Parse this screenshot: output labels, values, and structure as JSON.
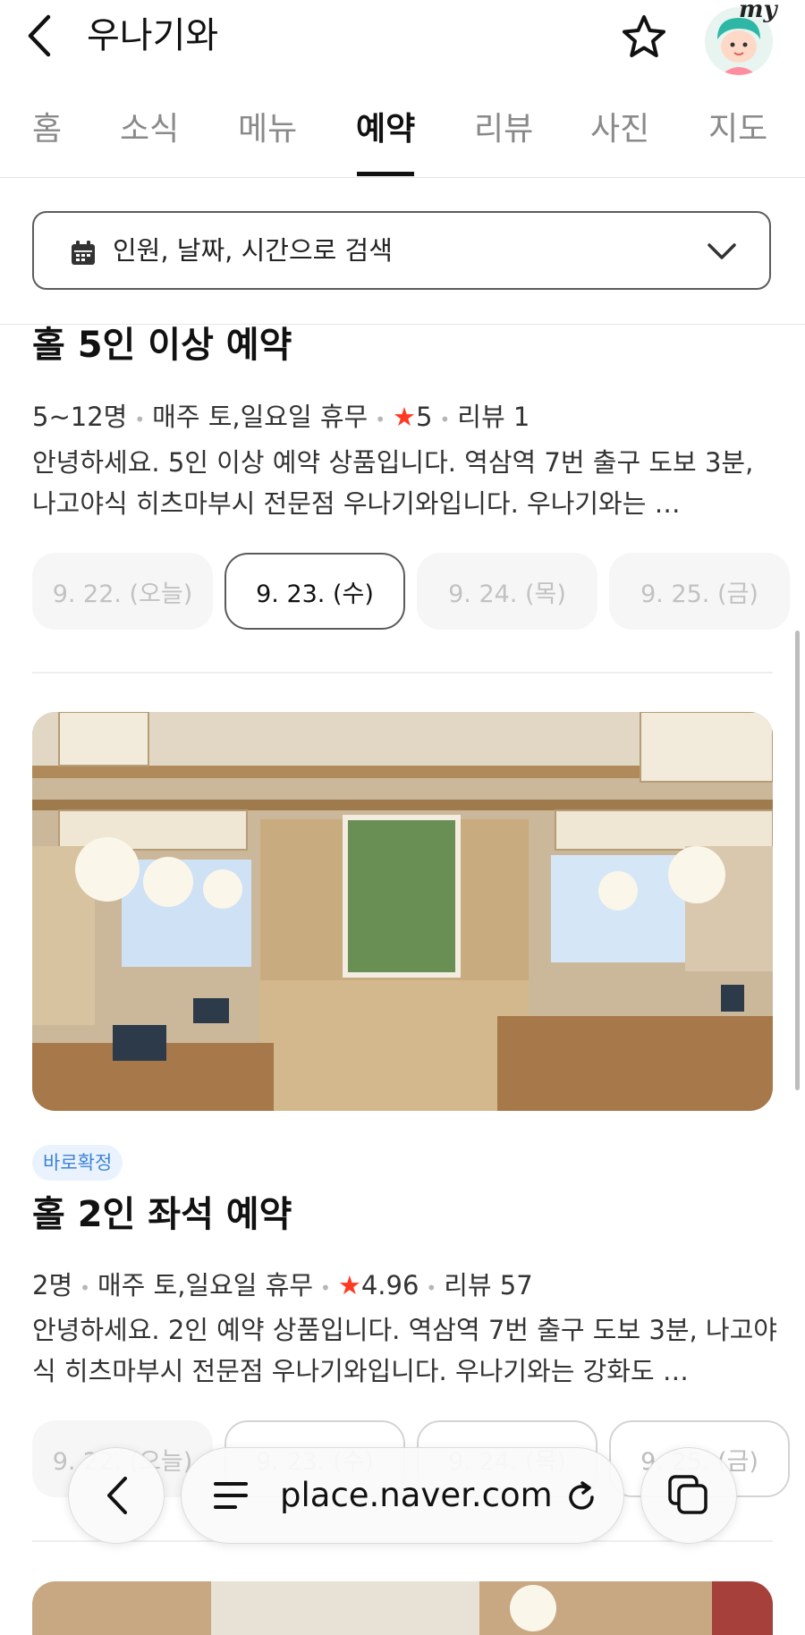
{
  "header": {
    "title": "우나기와",
    "avatar_text": "my",
    "icons": {
      "back": "chevron-left-icon",
      "favorite": "star-outline-icon"
    }
  },
  "tabs": [
    {
      "label": "홈",
      "active": false
    },
    {
      "label": "소식",
      "active": false
    },
    {
      "label": "메뉴",
      "active": false
    },
    {
      "label": "예약",
      "active": true
    },
    {
      "label": "리뷰",
      "active": false
    },
    {
      "label": "사진",
      "active": false
    },
    {
      "label": "지도",
      "active": false
    }
  ],
  "search": {
    "text": "인원, 날짜, 시간으로 검색",
    "icon": "calendar-icon"
  },
  "products": [
    {
      "title": "홀 5인 이상 예약",
      "capacity": "5~12명",
      "closed": "매주 토,일요일 휴무",
      "rating": "5",
      "reviews": "리뷰 1",
      "description": "안녕하세요. 5인 이상 예약 상품입니다. 역삼역 7번 출구 도보 3분, 나고야식 히츠마부시 전문점 우나기와입니다. 우나기와는 …",
      "dates": [
        {
          "label": "9. 22. (오늘)",
          "state": "disabled"
        },
        {
          "label": "9. 23. (수)",
          "state": "selected"
        },
        {
          "label": "9. 24. (목)",
          "state": "disabled"
        },
        {
          "label": "9. 25. (금)",
          "state": "disabled"
        }
      ]
    },
    {
      "badge": "바로확정",
      "title": "홀 2인 좌석 예약",
      "capacity": "2명",
      "closed": "매주 토,일요일 휴무",
      "rating": "4.96",
      "reviews": "리뷰 57",
      "description": "안녕하세요. 2인 예약 상품입니다. 역삼역 7번 출구 도보 3분, 나고야식 히츠마부시 전문점 우나기와입니다. 우나기와는 강화도 …",
      "dates": [
        {
          "label": "9. 22. (오늘)",
          "state": "disabled"
        },
        {
          "label": "9. 23. (수)",
          "state": "available"
        },
        {
          "label": "9. 24. (목)",
          "state": "available"
        },
        {
          "label": "9. 25. (금)",
          "state": "available"
        }
      ]
    }
  ],
  "browser": {
    "url": "place.naver.com",
    "icons": {
      "back": "chevron-left-icon",
      "menu": "hamburger-icon",
      "reload": "reload-icon",
      "tabs": "tabs-icon"
    }
  },
  "colors": {
    "star": "#ff3a22",
    "badge_text": "#3d83d8",
    "badge_bg": "#eaf3fd"
  }
}
